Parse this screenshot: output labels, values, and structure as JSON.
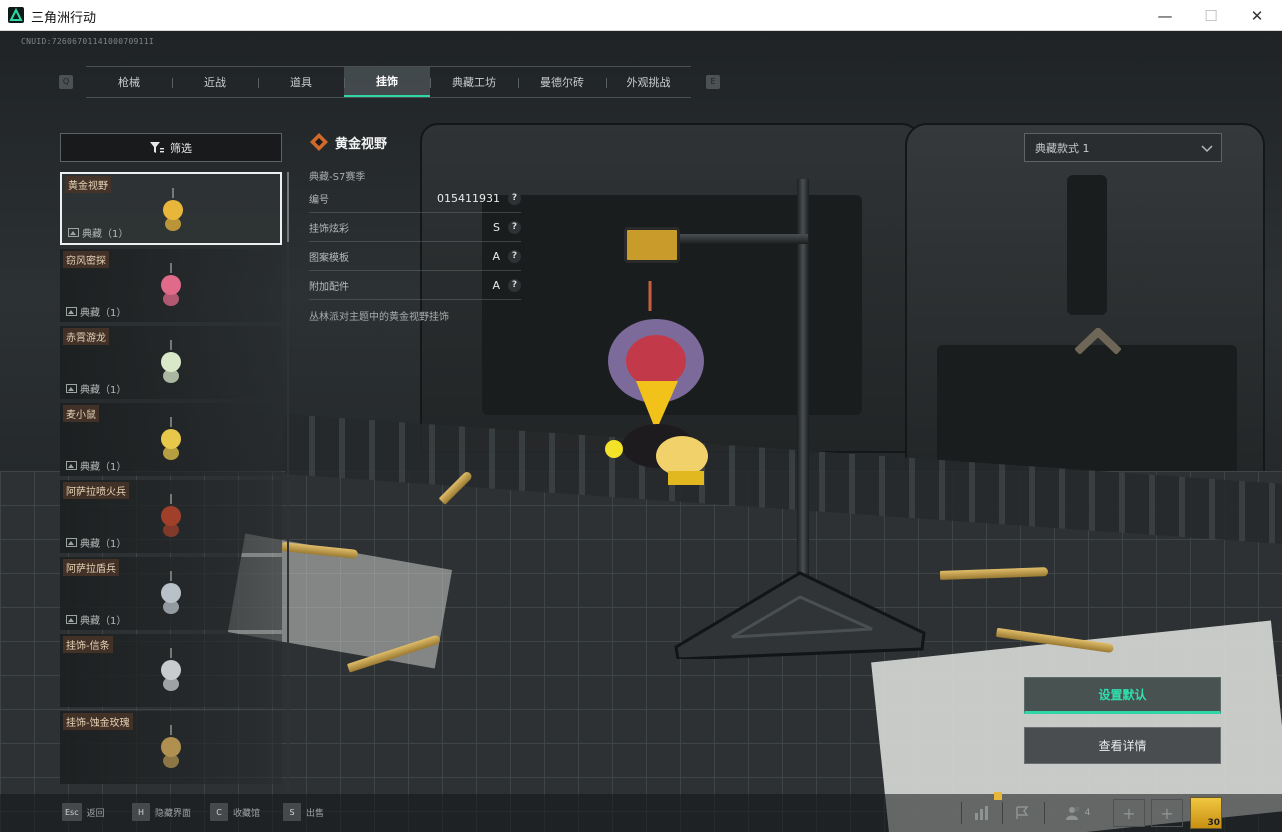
{
  "window": {
    "title": "三角洲行动",
    "minimize": "—",
    "maximize": "☐",
    "close": "✕"
  },
  "uid": "CNUID:7260670114100070911I",
  "nav": {
    "prev_key": "Q",
    "next_key": "E",
    "tabs": [
      {
        "label": "枪械",
        "active": false
      },
      {
        "label": "近战",
        "active": false
      },
      {
        "label": "道具",
        "active": false
      },
      {
        "label": "挂饰",
        "active": true
      },
      {
        "label": "典藏工坊",
        "active": false
      },
      {
        "label": "曼德尔砖",
        "active": false
      },
      {
        "label": "外观挑战",
        "active": false
      }
    ]
  },
  "filter": {
    "label": "筛选",
    "icon": "filter-icon"
  },
  "items": [
    {
      "name": "黄金视野",
      "tag": "典藏（1）",
      "selected": true,
      "color": "#e8b63a"
    },
    {
      "name": "窃风密探",
      "tag": "典藏（1）",
      "selected": false,
      "color": "#e06a8a"
    },
    {
      "name": "赤霄游龙",
      "tag": "典藏（1）",
      "selected": false,
      "color": "#d9e8c8"
    },
    {
      "name": "麦小鼠",
      "tag": "典藏（1）",
      "selected": false,
      "color": "#e8c84a"
    },
    {
      "name": "阿萨拉喷火兵",
      "tag": "典藏（1）",
      "selected": false,
      "color": "#a0402a"
    },
    {
      "name": "阿萨拉盾兵",
      "tag": "典藏（1）",
      "selected": false,
      "color": "#b8c0c8"
    },
    {
      "name": "挂饰-信条",
      "tag": "",
      "selected": false,
      "color": "#c8cccf"
    },
    {
      "name": "挂饰-蚀金玫瑰",
      "tag": "",
      "selected": false,
      "color": "#b09050"
    }
  ],
  "info": {
    "title": "黄金视野",
    "subtitle": "典藏-S7赛季",
    "rows": [
      {
        "label": "编号",
        "value": "015411931"
      },
      {
        "label": "挂饰炫彩",
        "value": "S"
      },
      {
        "label": "图案模板",
        "value": "A"
      },
      {
        "label": "附加配件",
        "value": "A"
      }
    ],
    "help_glyph": "?",
    "description": "丛林派对主题中的黄金视野挂饰"
  },
  "style_select": {
    "value": "典藏款式 1",
    "icon": "chevron-down-icon"
  },
  "buttons": {
    "set_default": "设置默认",
    "view_details": "查看详情"
  },
  "hotkeys": [
    {
      "key": "Esc",
      "label": "返回"
    },
    {
      "key": "H",
      "label": "隐藏界面"
    },
    {
      "key": "C",
      "label": "收藏馆"
    },
    {
      "key": "S",
      "label": "出售"
    }
  ],
  "tray": {
    "friends_count": "4",
    "avatar_level": "30",
    "plus": "+"
  },
  "accent": "#2fd6a6"
}
